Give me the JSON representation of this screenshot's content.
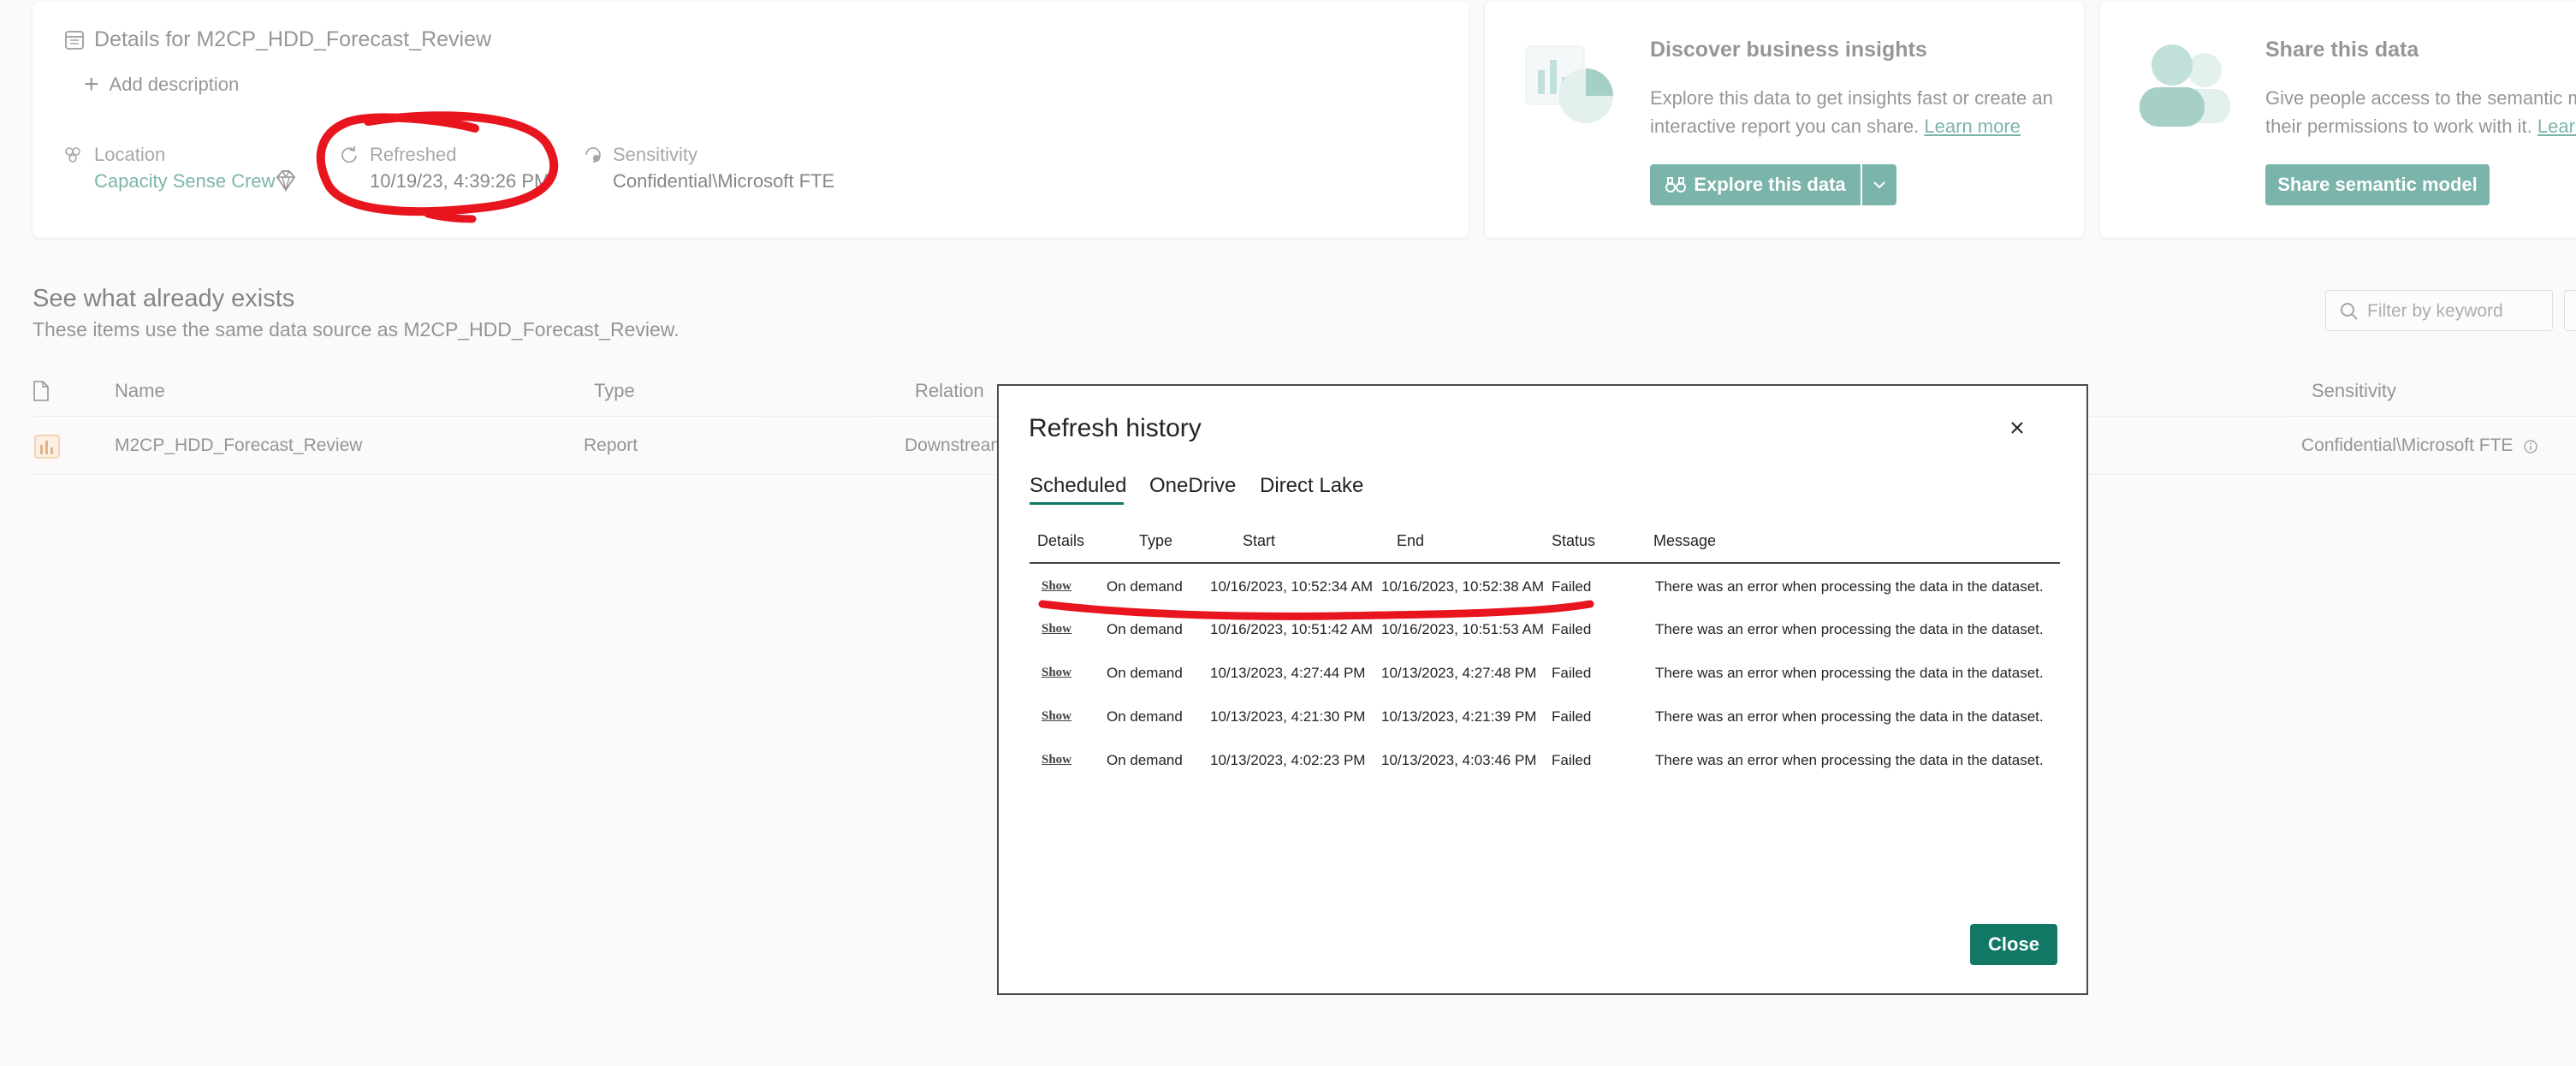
{
  "details": {
    "title": "Details for M2CP_HDD_Forecast_Review",
    "add_description": "Add description",
    "location_label": "Location",
    "location_value": "Capacity Sense Crew",
    "refreshed_label": "Refreshed",
    "refreshed_value": "10/19/23, 4:39:26 PM",
    "sensitivity_label": "Sensitivity",
    "sensitivity_value": "Confidential\\Microsoft FTE"
  },
  "insights": {
    "title": "Discover business insights",
    "body_line1": "Explore this data to get insights fast or create an",
    "body_line2": "interactive report you can share.",
    "learn_more": "Learn more",
    "explore_button": "Explore this data"
  },
  "share": {
    "title": "Share this data",
    "body_line1": "Give people access to the semantic mod",
    "body_line2": "their permissions to work with it.",
    "learn_more": "Learn",
    "share_button": "Share semantic model"
  },
  "exists": {
    "heading": "See what already exists",
    "subheading": "These items use the same data source as M2CP_HDD_Forecast_Review.",
    "filter_placeholder": "Filter by keyword",
    "columns": {
      "name": "Name",
      "type": "Type",
      "relation": "Relation",
      "sensitivity": "Sensitivity"
    },
    "row": {
      "name": "M2CP_HDD_Forecast_Review",
      "type": "Report",
      "relation": "Downstream",
      "sensitivity": "Confidential\\Microsoft FTE"
    }
  },
  "modal": {
    "title": "Refresh history",
    "tabs": [
      "Scheduled",
      "OneDrive",
      "Direct Lake"
    ],
    "columns": [
      "Details",
      "Type",
      "Start",
      "End",
      "Status",
      "Message"
    ],
    "rows": [
      {
        "details": "Show",
        "type": "On demand",
        "start": "10/16/2023, 10:52:34 AM",
        "end": "10/16/2023, 10:52:38 AM",
        "status": "Failed",
        "message": "There was an error when processing the data in the dataset."
      },
      {
        "details": "Show",
        "type": "On demand",
        "start": "10/16/2023, 10:51:42 AM",
        "end": "10/16/2023, 10:51:53 AM",
        "status": "Failed",
        "message": "There was an error when processing the data in the dataset."
      },
      {
        "details": "Show",
        "type": "On demand",
        "start": "10/13/2023, 4:27:44 PM",
        "end": "10/13/2023, 4:27:48 PM",
        "status": "Failed",
        "message": "There was an error when processing the data in the dataset."
      },
      {
        "details": "Show",
        "type": "On demand",
        "start": "10/13/2023, 4:21:30 PM",
        "end": "10/13/2023, 4:21:39 PM",
        "status": "Failed",
        "message": "There was an error when processing the data in the dataset."
      },
      {
        "details": "Show",
        "type": "On demand",
        "start": "10/13/2023, 4:02:23 PM",
        "end": "10/13/2023, 4:03:46 PM",
        "status": "Failed",
        "message": "There was an error when processing the data in the dataset."
      }
    ],
    "close_button": "Close"
  },
  "colors": {
    "accent": "#117865",
    "annotation": "#e8141e"
  }
}
